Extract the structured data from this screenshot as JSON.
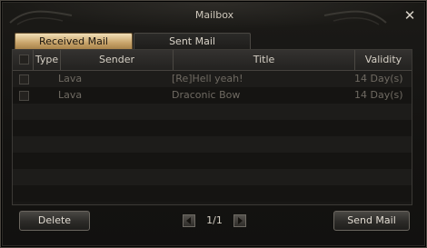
{
  "window": {
    "title": "Mailbox",
    "close_icon": "close-icon"
  },
  "tabs": [
    {
      "label": "Received Mail",
      "active": true
    },
    {
      "label": "Sent Mail",
      "active": false
    }
  ],
  "table": {
    "columns": [
      "Type",
      "Sender",
      "Title",
      "Validity"
    ],
    "rows": [
      {
        "sender": "Lava",
        "title": "[Re]Hell yeah!",
        "validity": "14 Day(s)",
        "checked": false
      },
      {
        "sender": "Lava",
        "title": "Draconic Bow",
        "validity": "14 Day(s)",
        "checked": false
      }
    ]
  },
  "footer": {
    "delete_label": "Delete",
    "send_label": "Send Mail",
    "page_indicator": "1/1",
    "prev_icon": "arrow-left-icon",
    "next_icon": "arrow-right-icon"
  },
  "colors": {
    "tab_active": "#c9a56c",
    "text_dim": "#6f6a62",
    "background": "#141311"
  }
}
